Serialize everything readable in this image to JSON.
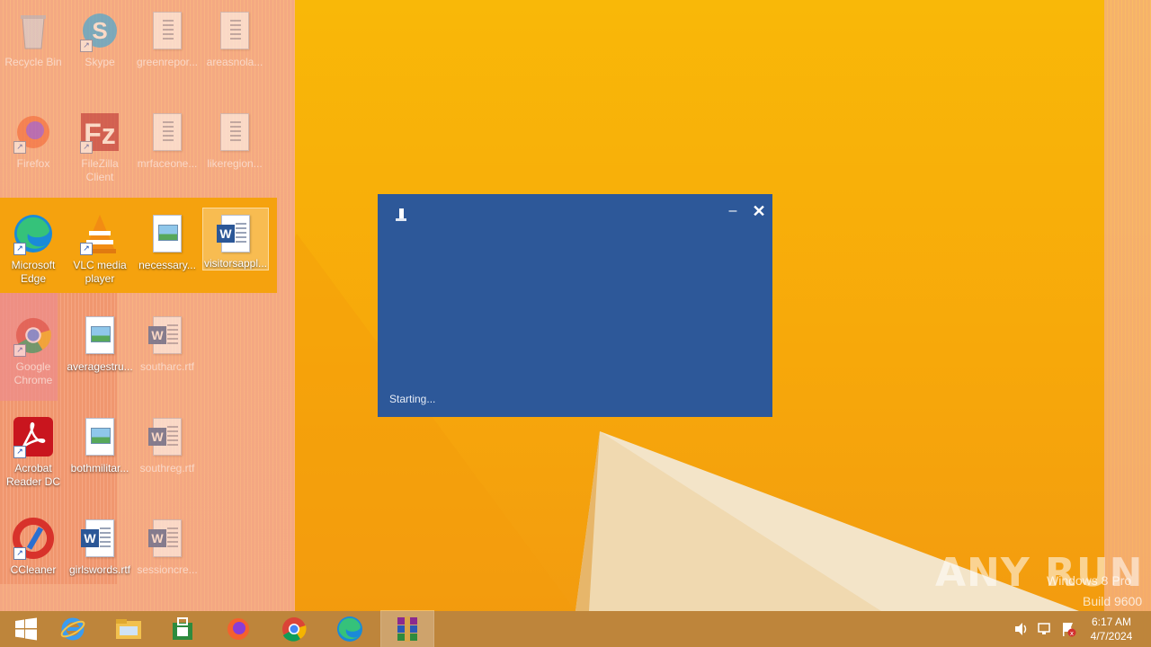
{
  "desktop": {
    "icons": [
      {
        "label": "Recycle Bin",
        "kind": "recycle"
      },
      {
        "label": "Skype",
        "kind": "skype"
      },
      {
        "label": "greenrepor...",
        "kind": "doc"
      },
      {
        "label": "areasnola...",
        "kind": "doc"
      },
      {
        "label": "Firefox",
        "kind": "firefox"
      },
      {
        "label": "FileZilla Client",
        "kind": "filezilla"
      },
      {
        "label": "mrfaceone...",
        "kind": "doc"
      },
      {
        "label": "likeregion...",
        "kind": "doc"
      },
      {
        "label": "Microsoft Edge",
        "kind": "edge"
      },
      {
        "label": "VLC media player",
        "kind": "vlc"
      },
      {
        "label": "necessary...",
        "kind": "image"
      },
      {
        "label": "visitorsappl...",
        "kind": "word"
      },
      {
        "label": "Google Chrome",
        "kind": "chrome"
      },
      {
        "label": "averagestru...",
        "kind": "image"
      },
      {
        "label": "southarc.rtf",
        "kind": "word"
      },
      {
        "label": "Acrobat Reader DC",
        "kind": "acrobat"
      },
      {
        "label": "bothmilitar...",
        "kind": "image"
      },
      {
        "label": "southreg.rtf",
        "kind": "word"
      },
      {
        "label": "CCleaner",
        "kind": "ccleaner"
      },
      {
        "label": "girlswords.rtf",
        "kind": "word"
      },
      {
        "label": "sessioncre...",
        "kind": "word"
      }
    ]
  },
  "splash": {
    "status": "Starting...",
    "minimize_label": "–",
    "close_label": "✕"
  },
  "taskbar": {
    "buttons": [
      {
        "name": "start-button",
        "icon": "windows-logo-icon"
      },
      {
        "name": "taskbar-ie",
        "icon": "internet-explorer-icon"
      },
      {
        "name": "taskbar-explorer",
        "icon": "file-explorer-icon"
      },
      {
        "name": "taskbar-store",
        "icon": "store-icon"
      },
      {
        "name": "taskbar-firefox",
        "icon": "firefox-icon"
      },
      {
        "name": "taskbar-chrome",
        "icon": "chrome-icon"
      },
      {
        "name": "taskbar-edge",
        "icon": "edge-icon"
      },
      {
        "name": "taskbar-winrar",
        "icon": "winrar-icon"
      }
    ],
    "clock": {
      "time": "6:17 AM",
      "date": "4/7/2024"
    }
  },
  "watermark": {
    "brand": "ANY RUN",
    "os_line1": "Windows 8 Pro",
    "os_line2": "Build 9600"
  }
}
